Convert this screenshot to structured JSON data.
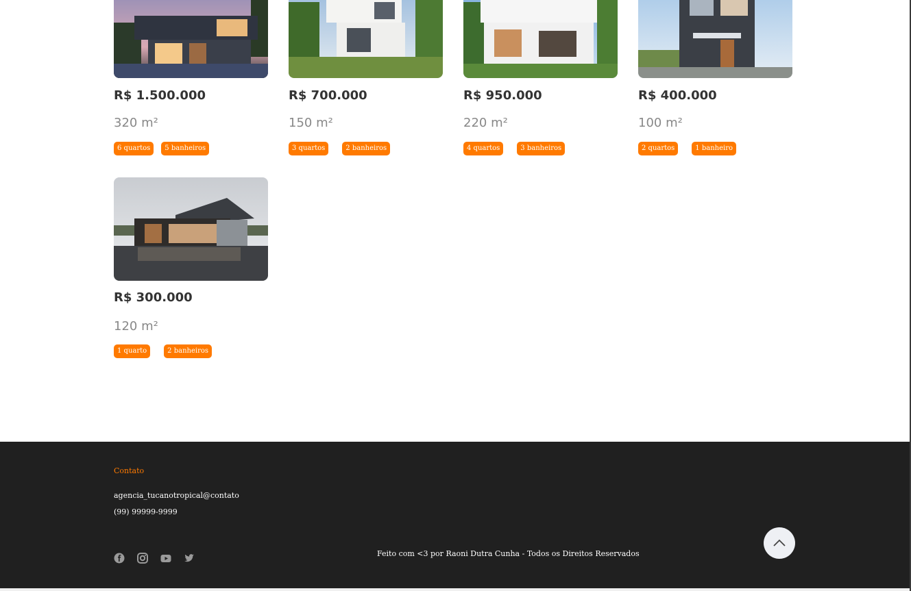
{
  "listings": [
    {
      "price": "R$ 1.500.000",
      "area": "320 m²",
      "rooms": "6 quartos",
      "baths": "5 banheiros"
    },
    {
      "price": "R$ 700.000",
      "area": "150 m²",
      "rooms": "3 quartos",
      "baths": "2 banheiros"
    },
    {
      "price": "R$ 950.000",
      "area": "220 m²",
      "rooms": "4 quartos",
      "baths": "3 banheiros"
    },
    {
      "price": "R$ 400.000",
      "area": "100 m²",
      "rooms": "2 quartos",
      "baths": "1 banheiro"
    },
    {
      "price": "R$ 300.000",
      "area": "120 m²",
      "rooms": "1 quarto",
      "baths": "2 banheiros"
    }
  ],
  "footer": {
    "contact_title": "Contato",
    "email": "agencia_tucanotropical@contato",
    "phone": "(99) 99999-9999",
    "credits": "Feito com <3 por Raoni Dutra Cunha - Todos os Direitos Reservados",
    "socials": [
      "facebook-icon",
      "instagram-icon",
      "youtube-icon",
      "twitter-icon"
    ]
  },
  "colors": {
    "accent": "#ff7a00",
    "footer_bg": "#202020"
  }
}
